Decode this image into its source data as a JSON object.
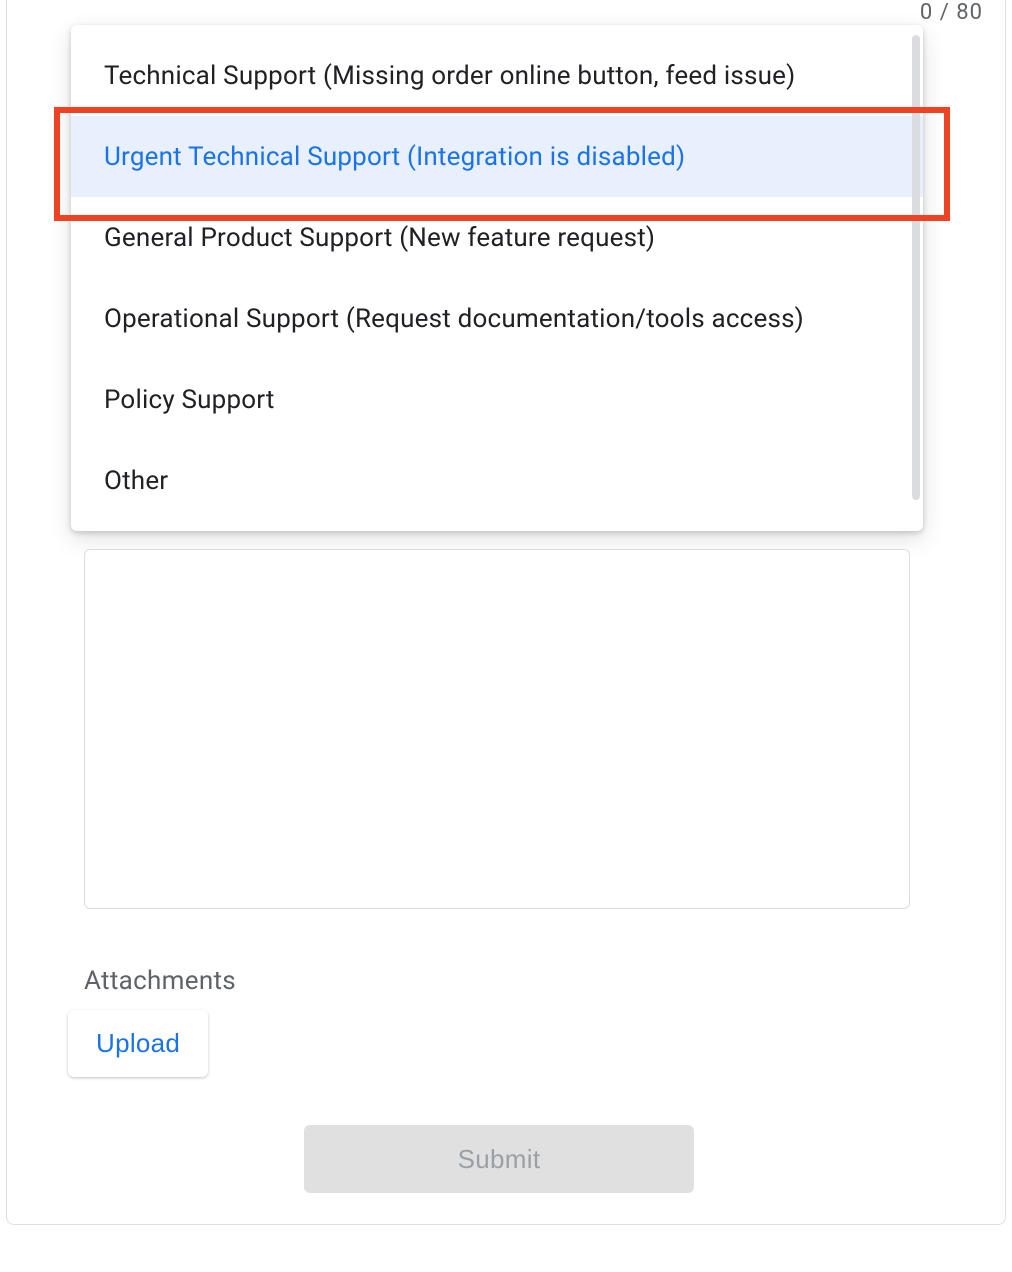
{
  "counter": {
    "text": "0 / 80"
  },
  "dropdown": {
    "options": [
      {
        "label": "Technical Support (Missing order online button, feed issue)",
        "selected": false
      },
      {
        "label": "Urgent Technical Support (Integration is disabled)",
        "selected": true
      },
      {
        "label": "General Product Support (New feature request)",
        "selected": false
      },
      {
        "label": "Operational Support (Request documentation/tools access)",
        "selected": false
      },
      {
        "label": "Policy Support",
        "selected": false
      },
      {
        "label": "Other",
        "selected": false
      }
    ]
  },
  "textarea": {
    "value": ""
  },
  "attachments": {
    "label": "Attachments",
    "upload_button": "Upload"
  },
  "submit": {
    "label": "Submit"
  }
}
